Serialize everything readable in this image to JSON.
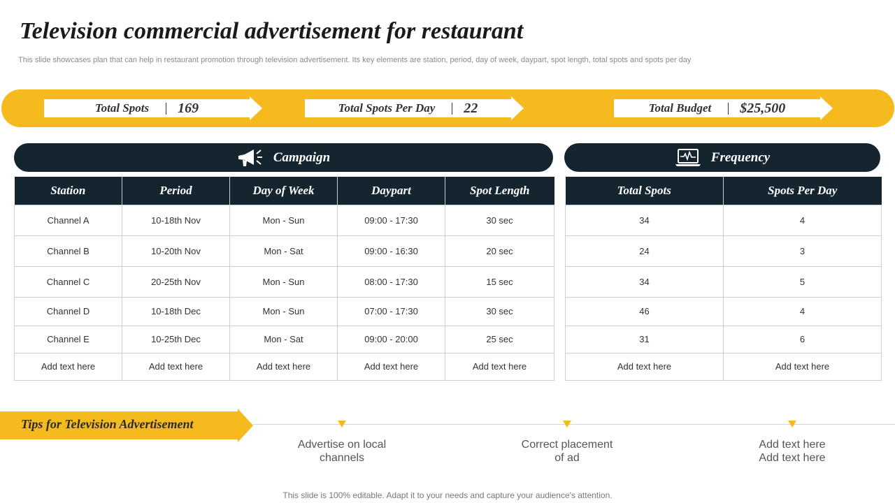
{
  "title": "Television commercial advertisement for restaurant",
  "subtitle": "This slide showcases plan that can help in restaurant promotion through television advertisement. Its key elements are station, period, day of week, daypart, spot length, total spots and spots per day",
  "summary": [
    {
      "label": "Total Spots",
      "value": "169"
    },
    {
      "label": "Total Spots Per Day",
      "value": "22"
    },
    {
      "label": "Total Budget",
      "value": "$25,500"
    }
  ],
  "campaign": {
    "heading": "Campaign",
    "icon": "megaphone-icon",
    "columns": [
      "Station",
      "Period",
      "Day of Week",
      "Daypart",
      "Spot Length"
    ],
    "rows": [
      [
        "Channel  A",
        "10-18th Nov",
        "Mon - Sun",
        "09:00 - 17:30",
        "30 sec"
      ],
      [
        "Channel  B",
        "10-20th Nov",
        "Mon - Sat",
        "09:00 - 16:30",
        "20 sec"
      ],
      [
        "Channel  C",
        "20-25th Nov",
        "Mon - Sun",
        "08:00 - 17:30",
        "15 sec"
      ],
      [
        "Channel  D",
        "10-18th Dec",
        "Mon - Sun",
        "07:00 - 17:30",
        "30 sec"
      ],
      [
        "Channel  E",
        "10-25th Dec",
        "Mon - Sat",
        "09:00 - 20:00",
        "25 sec"
      ],
      [
        "Add text here",
        "Add text here",
        "Add text here",
        "Add text here",
        "Add text here"
      ]
    ]
  },
  "frequency": {
    "heading": "Frequency",
    "icon": "laptop-pulse-icon",
    "columns": [
      "Total Spots",
      "Spots Per Day"
    ],
    "rows": [
      [
        "34",
        "4"
      ],
      [
        "24",
        "3"
      ],
      [
        "34",
        "5"
      ],
      [
        "46",
        "4"
      ],
      [
        "31",
        "6"
      ],
      [
        "Add text here",
        "Add text here"
      ]
    ]
  },
  "tips": {
    "heading": "Tips for Television Advertisement",
    "items": [
      {
        "line1": "Advertise on local",
        "line2": "channels"
      },
      {
        "line1": "Correct placement",
        "line2": "of ad"
      },
      {
        "line1": "Add text here",
        "line2": "Add text here"
      }
    ]
  },
  "footer": "This slide is 100% editable. Adapt it to your needs and capture your audience's attention.",
  "colors": {
    "accent": "#f4ba1e",
    "navy": "#14252f",
    "grid": "#c8ced3"
  }
}
